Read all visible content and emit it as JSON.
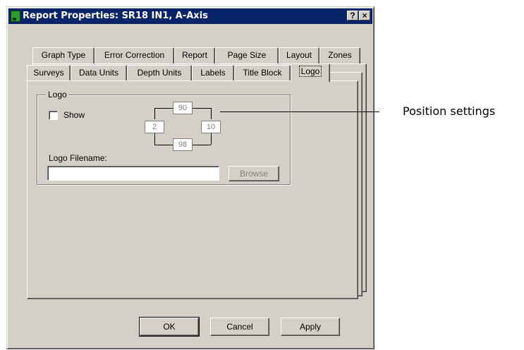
{
  "window": {
    "title": "Report Properties: SR18 IN1, A-Axis",
    "help_label": "?",
    "close_label": "×"
  },
  "tabs": {
    "row1": [
      "Graph Type",
      "Error Correction",
      "Report",
      "Page Size",
      "Layout",
      "Zones"
    ],
    "row2": [
      "Surveys",
      "Data Units",
      "Depth Units",
      "Labels",
      "Title Block",
      "Logo"
    ],
    "active": "Logo"
  },
  "logo_group": {
    "legend": "Logo",
    "show_label": "Show",
    "show_checked": false,
    "position": {
      "top": "90",
      "left": "2",
      "right": "10",
      "bottom": "98"
    },
    "filename_label": "Logo Filename:",
    "filename_value": "",
    "browse_label": "Browse"
  },
  "footer": {
    "ok_label": "OK",
    "cancel_label": "Cancel",
    "apply_label": "Apply"
  },
  "callout": {
    "text": "Position settings"
  }
}
